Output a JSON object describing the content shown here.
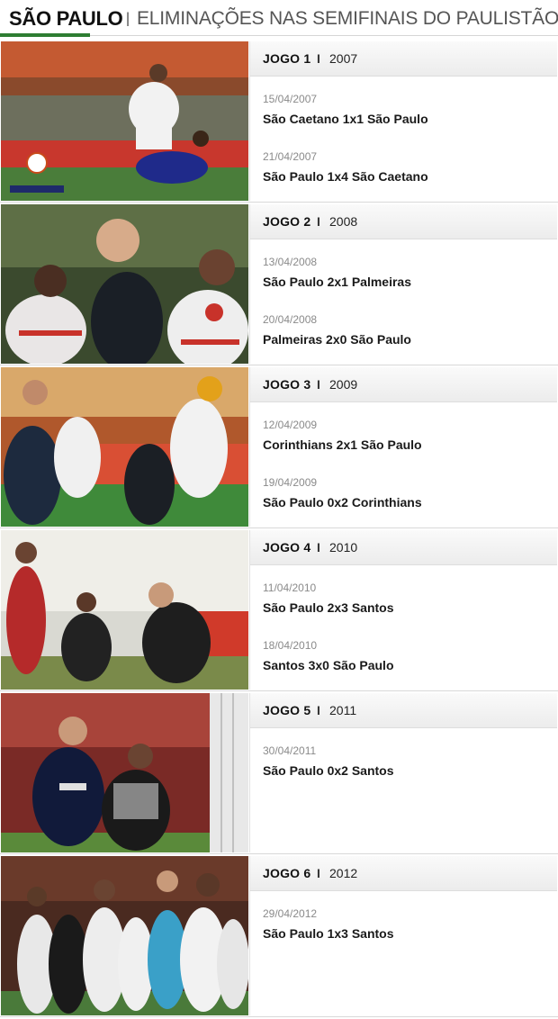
{
  "header": {
    "brand": "SÃO PAULO",
    "separator": "I",
    "subtitle": "ELIMINAÇÕES NAS SEMIFINAIS DO PAULISTÃO",
    "accent_color": "#2e7d32"
  },
  "games": [
    {
      "label": "JOGO 1",
      "separator": "I",
      "year": "2007",
      "matches": [
        {
          "date": "15/04/2007",
          "score": "São Caetano 1x1 São Paulo"
        },
        {
          "date": "21/04/2007",
          "score": "São Paulo 1x4 São Caetano"
        }
      ]
    },
    {
      "label": "JOGO 2",
      "separator": "I",
      "year": "2008",
      "matches": [
        {
          "date": "13/04/2008",
          "score": "São Paulo 2x1 Palmeiras"
        },
        {
          "date": "20/04/2008",
          "score": "Palmeiras 2x0 São Paulo"
        }
      ]
    },
    {
      "label": "JOGO 3",
      "separator": "I",
      "year": "2009",
      "matches": [
        {
          "date": "12/04/2009",
          "score": "Corinthians 2x1 São Paulo"
        },
        {
          "date": "19/04/2009",
          "score": "São Paulo 0x2 Corinthians"
        }
      ]
    },
    {
      "label": "JOGO 4",
      "separator": "I",
      "year": "2010",
      "matches": [
        {
          "date": "11/04/2010",
          "score": "São Paulo 2x3 Santos"
        },
        {
          "date": "18/04/2010",
          "score": "Santos 3x0 São Paulo"
        }
      ]
    },
    {
      "label": "JOGO 5",
      "separator": "I",
      "year": "2011",
      "matches": [
        {
          "date": "30/04/2011",
          "score": "São Paulo 0x2 Santos"
        }
      ]
    },
    {
      "label": "JOGO 6",
      "separator": "I",
      "year": "2012",
      "matches": [
        {
          "date": "29/04/2012",
          "score": "São Paulo 1x3 Santos"
        }
      ]
    }
  ]
}
